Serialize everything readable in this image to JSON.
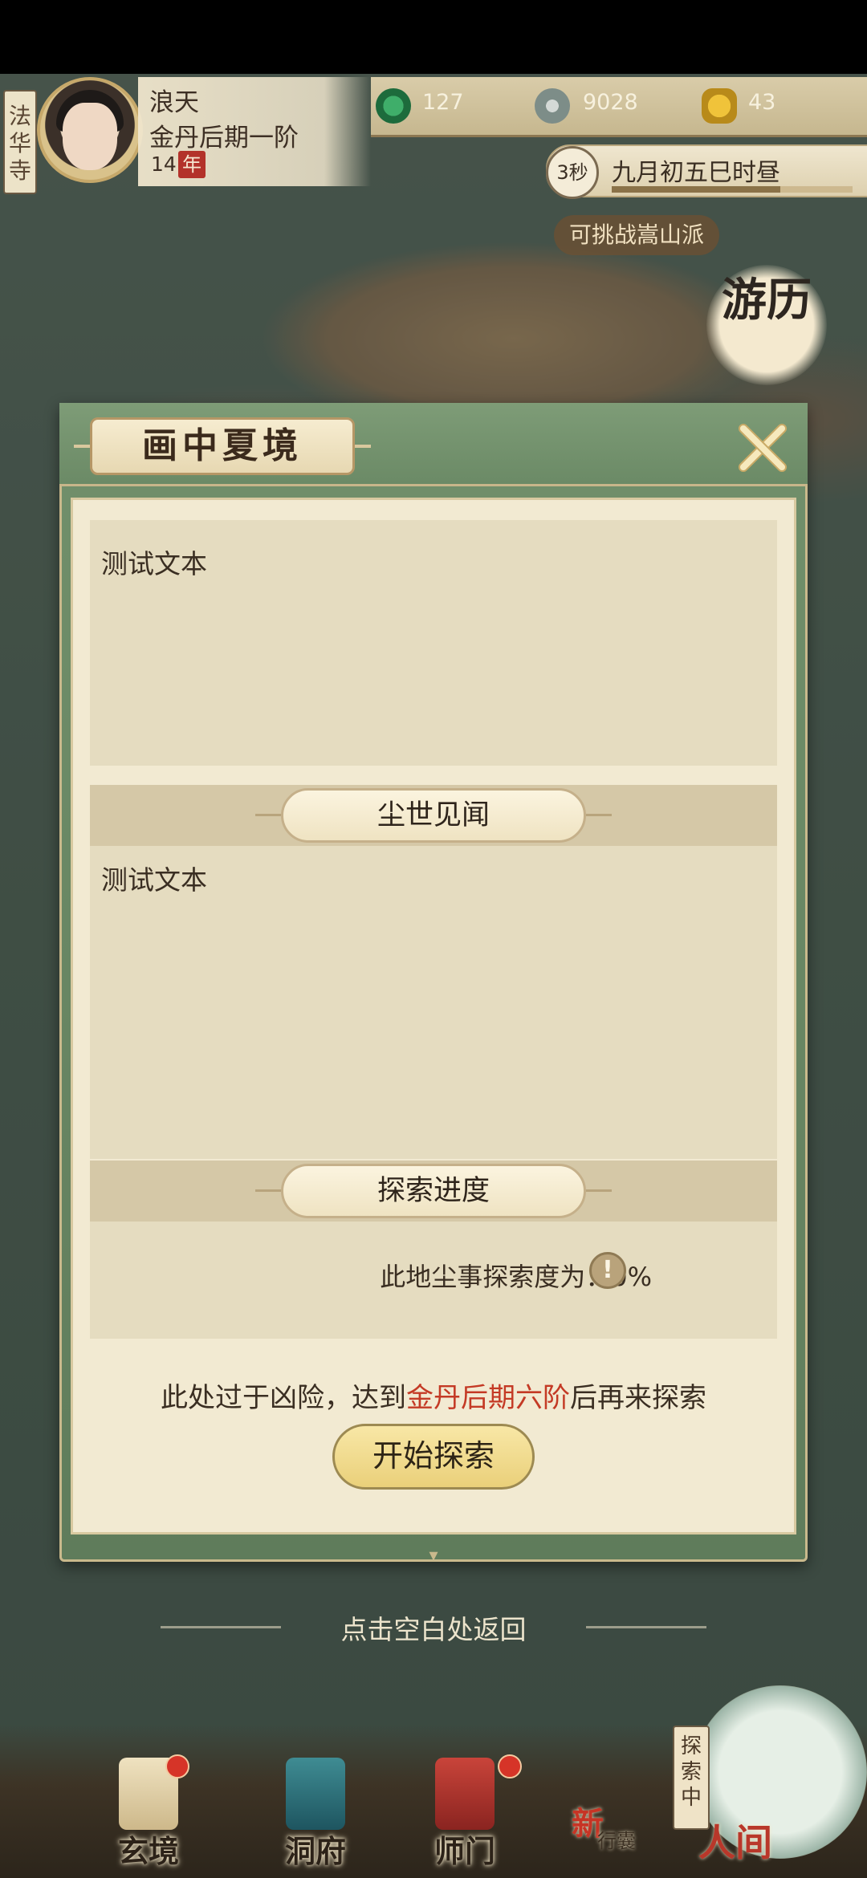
{
  "player": {
    "temple": "法华寺",
    "name": "浪天",
    "rank": "金丹后期一阶",
    "age": "14",
    "age_unit": "年"
  },
  "resources": [
    {
      "icon": "jade-swirl-icon",
      "value": "127"
    },
    {
      "icon": "coin-icon",
      "value": "9028"
    },
    {
      "icon": "strength-icon",
      "value": "43"
    }
  ],
  "time": {
    "countdown": "3秒",
    "date": "九月初五巳时昼",
    "progress": 0.7
  },
  "map": {
    "challenge": "可挑战嵩山派",
    "travel_label": "游历"
  },
  "modal": {
    "title": "画中夏境",
    "section1_text": "测试文本",
    "section2_title": "尘世见闻",
    "section2_text": "测试文本",
    "section3_title": "探索进度",
    "progress_label": "此地尘事探索度为：0%",
    "warning_prefix": "此处过于凶险，达到",
    "warning_highlight": "金丹后期六阶",
    "warning_suffix": "后再来探索",
    "start_button": "开始探索"
  },
  "return_hint": "点击空白处返回",
  "nav": {
    "items": [
      {
        "label": "玄境",
        "icon": "scroll-icon"
      },
      {
        "label": "洞府",
        "icon": "pavilion-icon"
      },
      {
        "label": "师门",
        "icon": "banner-icon"
      }
    ],
    "new_tag": "新",
    "bag_label": "行囊",
    "exploring_tag": "探索中",
    "human_world": "人间"
  },
  "colors": {
    "accent_red": "#c43a25",
    "modal_green": "#6b8a66",
    "paper": "#f2ead2",
    "button_gold": "#ead07a"
  }
}
